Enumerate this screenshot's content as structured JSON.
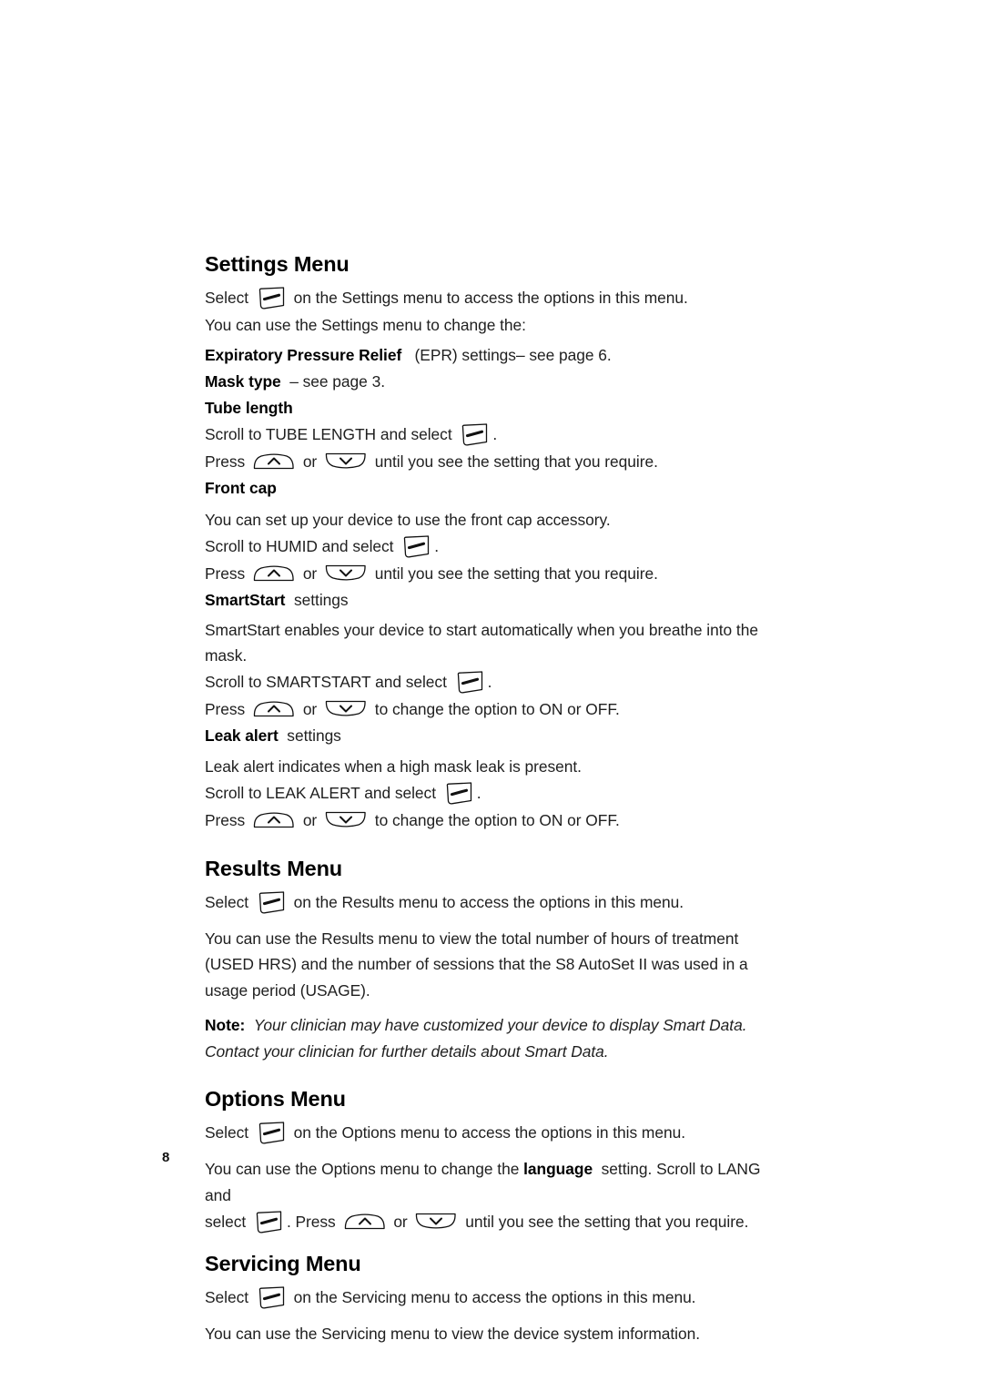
{
  "document": {
    "page_number": "8",
    "icons": {
      "select": "select-button-icon",
      "up": "up-arrow-button-icon",
      "down": "down-arrow-button-icon"
    }
  },
  "sections": {
    "settings": {
      "heading": "Settings Menu",
      "select_prefix": "Select",
      "select_suffix": "on the Settings menu to access the options in this menu.",
      "intro": "You can use the Settings menu to change the:",
      "items": {
        "epr_bold": "Expiratory Pressure Relief",
        "epr_rest": "(EPR) settings",
        "epr_tail": "– see page 6.",
        "mask_bold": "Mask type",
        "mask_rest": "– see page 3.",
        "tube_bold": "Tube length"
      },
      "tube": {
        "scroll_prefix": "Scroll to TUBE LENGTH and select",
        "scroll_suffix": ".",
        "press_prefix": "Press",
        "press_mid": "or",
        "press_suffix": "until you see the setting that you require."
      },
      "front_cap": {
        "label": "Front cap",
        "desc": "You can set up your device to use the front cap accessory.",
        "scroll_prefix": "Scroll to HUMID and select",
        "scroll_suffix": ".",
        "press_prefix": "Press",
        "press_mid": "or",
        "press_suffix": "until you see the setting that you require."
      },
      "smartstart": {
        "label_bold": "SmartStart",
        "label_rest": "settings",
        "desc": "SmartStart enables your device to start automatically when you breathe into the mask.",
        "scroll_prefix": "Scroll to SMARTSTART and select",
        "scroll_suffix": ".",
        "press_prefix": "Press",
        "press_mid": "or",
        "press_suffix": "to change the option to ON or OFF."
      },
      "leak_alert": {
        "label_bold": "Leak alert",
        "label_rest": "settings",
        "desc": "Leak alert indicates when a high mask leak is present.",
        "scroll_prefix": "Scroll to LEAK ALERT and select",
        "scroll_suffix": ".",
        "press_prefix": "Press",
        "press_mid": "or",
        "press_suffix": "to change the option to ON or OFF."
      }
    },
    "results": {
      "heading": "Results Menu",
      "select_prefix": "Select",
      "select_suffix": "on the Results menu to access the options in this menu.",
      "body": "You can use the Results menu to view the total number of hours of treatment (USED HRS) and the number of sessions that the S8 AutoSet II was used in a usage period (USAGE).",
      "note_label": "Note:",
      "note_text": "Your clinician may have customized your device to display Smart Data. Contact your clinician for further details about Smart Data."
    },
    "options": {
      "heading": "Options Menu",
      "select_prefix": "Select",
      "select_suffix": "on the Options menu to access the options in this menu.",
      "body_part1": "You can use the Options menu to change the",
      "body_bold": "language",
      "body_part2": "setting. Scroll to LANG and",
      "body_line2_prefix": "select",
      "body_line2_mid": ". Press",
      "body_line2_or": "or",
      "body_line2_suffix": "until you see the setting that you require."
    },
    "servicing": {
      "heading": "Servicing Menu",
      "select_prefix": "Select",
      "select_suffix": "on the Servicing menu to access the options in this menu.",
      "body": "You can use the Servicing menu to view the device system information."
    }
  }
}
